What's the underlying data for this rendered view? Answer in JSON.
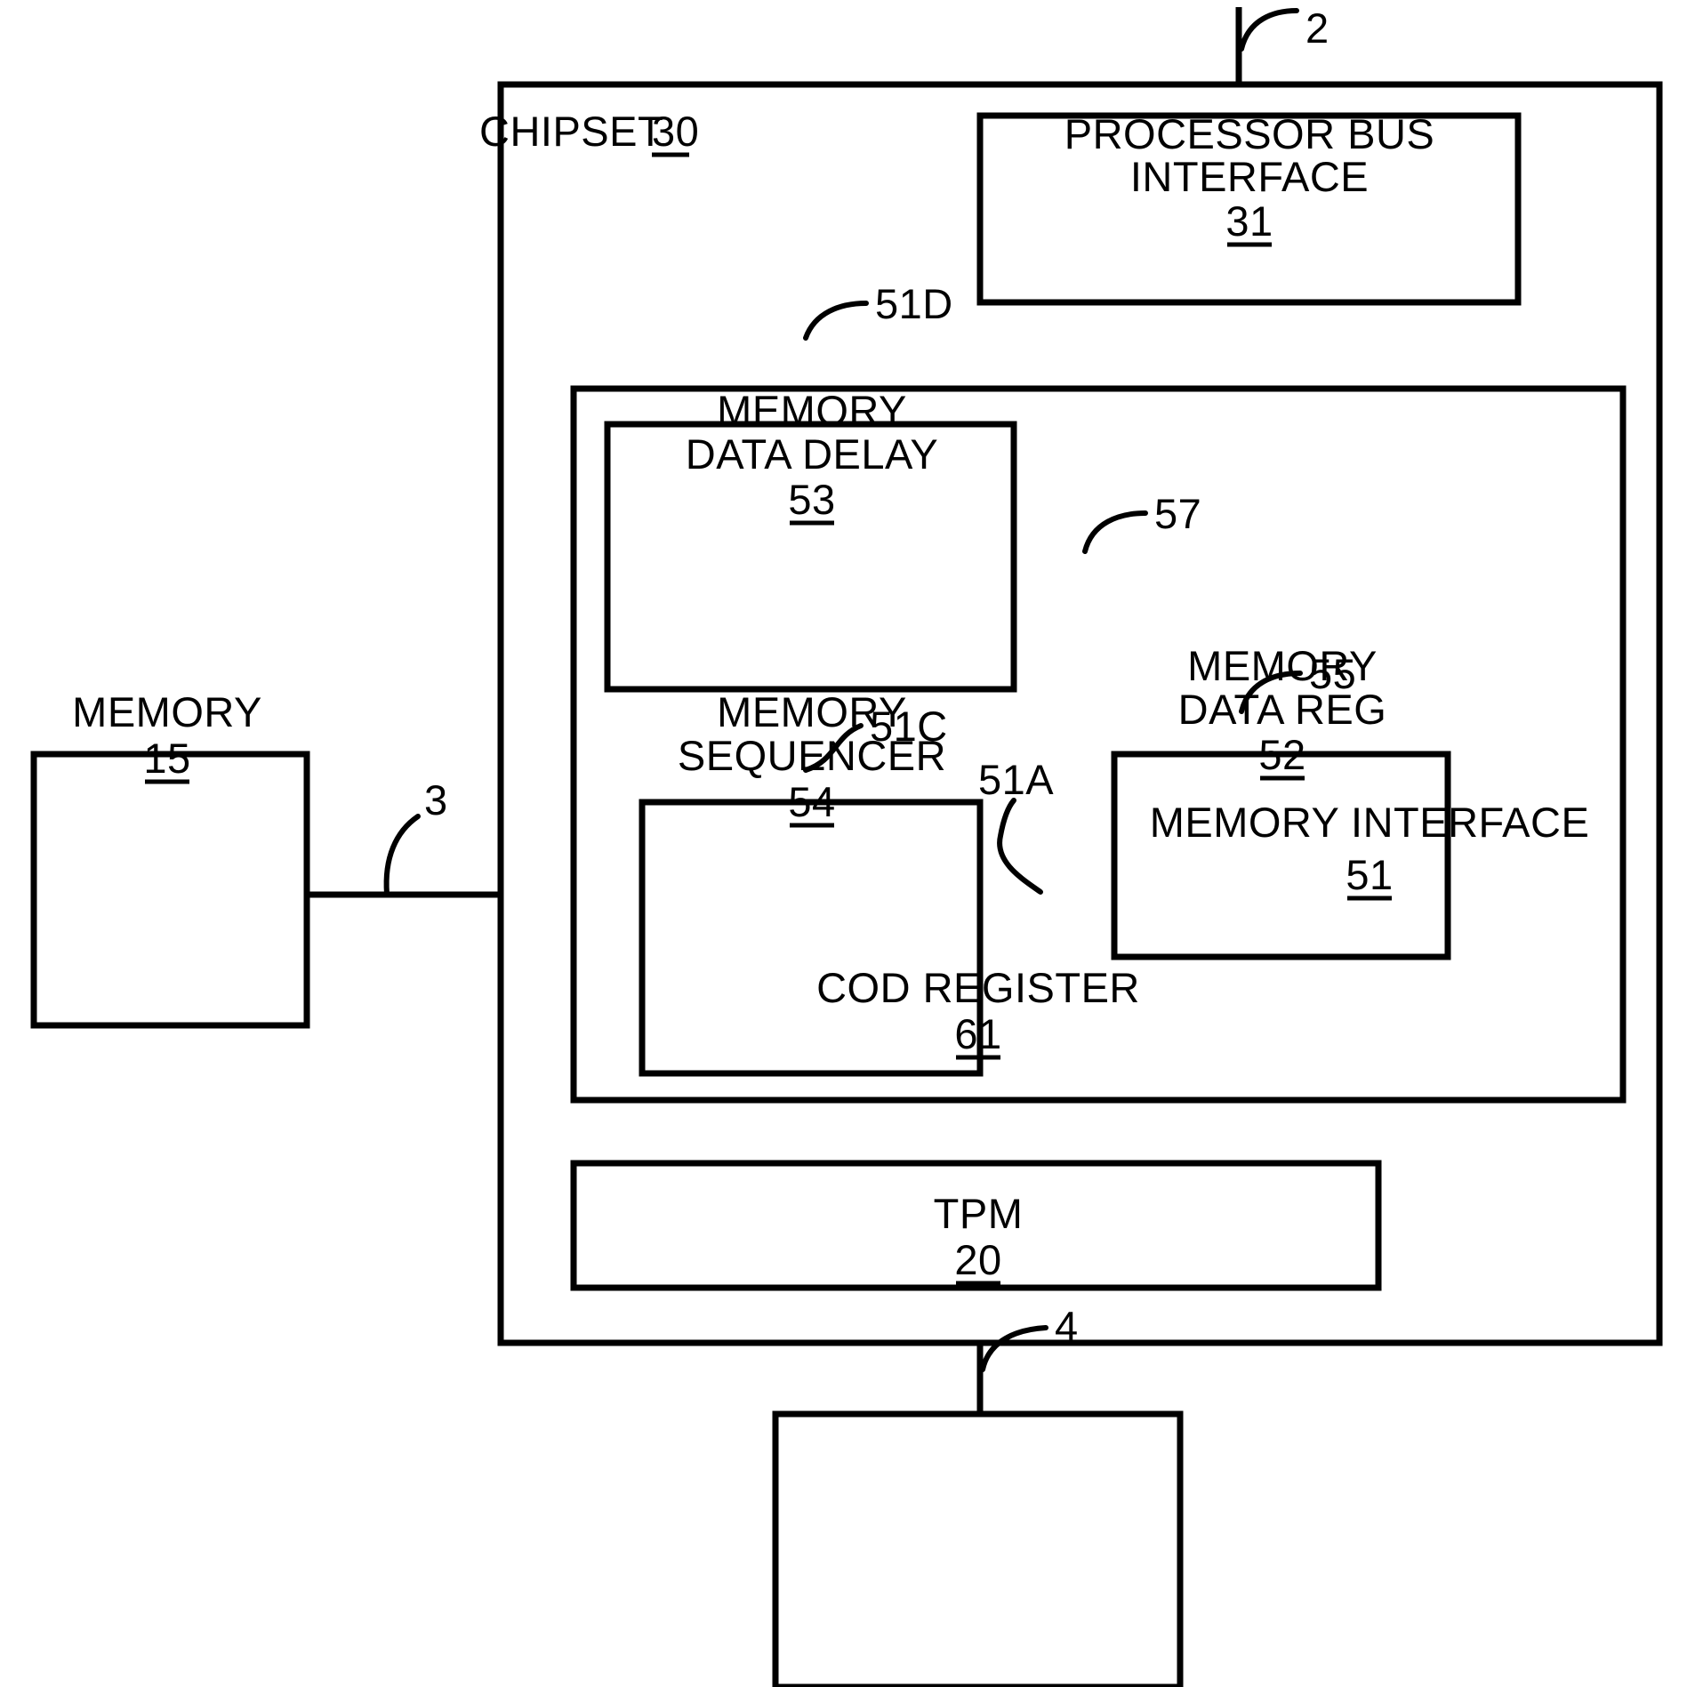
{
  "figure": {
    "type": "patent-block-diagram",
    "background": "#ffffff",
    "line_color": "#000000"
  },
  "blocks": {
    "chipset": {
      "label": "CHIPSET",
      "ref": "30"
    },
    "processor_bus_interface": {
      "label_line1": "PROCESSOR BUS",
      "label_line2": "INTERFACE",
      "ref": "31"
    },
    "memory_data_delay": {
      "label_line1": "MEMORY",
      "label_line2": "DATA DELAY",
      "ref": "53"
    },
    "memory_sequencer": {
      "label_line1": "MEMORY",
      "label_line2": "SEQUENCER",
      "ref": "54"
    },
    "memory_data_reg": {
      "label_line1": "MEMORY",
      "label_line2": "DATA REG",
      "ref": "52"
    },
    "memory_interface": {
      "label": "MEMORY INTERFACE",
      "ref": "51"
    },
    "cod_register": {
      "label": "COD REGISTER",
      "ref": "61"
    },
    "memory": {
      "label": "MEMORY",
      "ref": "15"
    },
    "tpm": {
      "label": "TPM",
      "ref": "20"
    }
  },
  "connectors": [
    {
      "name": "processor-bus-line",
      "label": "2"
    },
    {
      "name": "memory-bus-line",
      "label": "3"
    },
    {
      "name": "tpm-bus-line",
      "label": "4"
    },
    {
      "name": "delay-input-line",
      "label": "51D"
    },
    {
      "name": "delay-to-sequencer-line",
      "label": "51C"
    },
    {
      "name": "sequencer-to-datareg-line",
      "label": "51A"
    },
    {
      "name": "delay-to-cod-line",
      "label": "57"
    },
    {
      "name": "pbi-to-datareg-line",
      "label": "55"
    }
  ],
  "leader_labels": {
    "two": "2",
    "three": "3",
    "four": "4",
    "fifty_one_d": "51D",
    "fifty_one_c": "51C",
    "fifty_one_a": "51A",
    "fifty_five": "55",
    "fifty_seven": "57"
  }
}
